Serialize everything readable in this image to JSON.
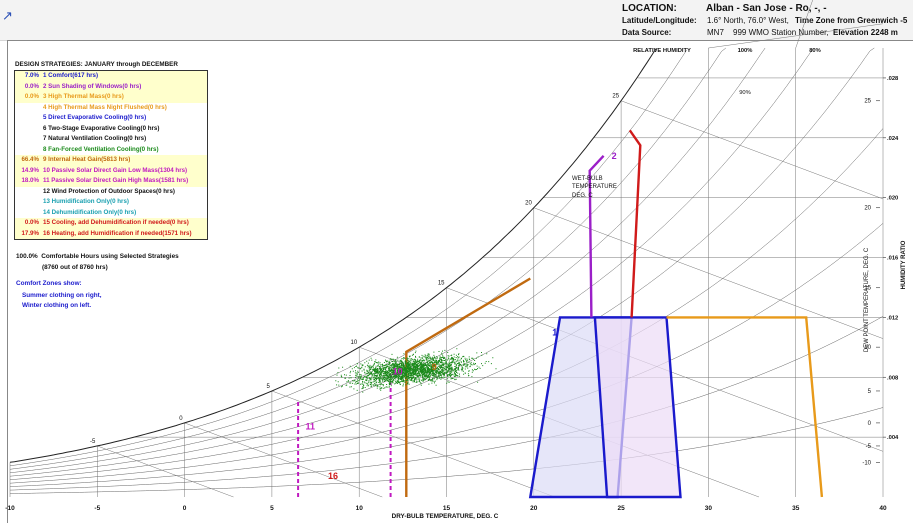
{
  "header": {
    "location_label": "LOCATION:",
    "location_value": "Alban - San Jose - Ro, -, -",
    "latlon_label": "Latitude/Longitude:",
    "latlon_value": "1.6° North, 76.0° West,",
    "timezone_label": "Time Zone from Greenwich -5",
    "source_label": "Data Source:",
    "source_code": "MN7",
    "source_value": "999 WMO Station Number,",
    "elevation_label": "Elevation 2248 m"
  },
  "design_title": "DESIGN STRATEGIES: JANUARY through DECEMBER",
  "strategies": [
    {
      "pct": "7.0%",
      "text": "1 Comfort(617 hrs)",
      "color": "#1a1acc",
      "bg": "#ffffcc"
    },
    {
      "pct": "0.0%",
      "text": "2 Sun Shading of Windows(0 hrs)",
      "color": "#9b1fc8",
      "bg": "#ffffcc"
    },
    {
      "pct": "0.0%",
      "text": "3 High Thermal Mass(0 hrs)",
      "color": "#e89a1a",
      "bg": "#ffffcc"
    },
    {
      "pct": "",
      "text": "4 High Thermal Mass Night Flushed(0 hrs)",
      "color": "#e89a1a",
      "bg": "#ffffff"
    },
    {
      "pct": "",
      "text": "5 Direct Evaporative Cooling(0 hrs)",
      "color": "#1a1acc",
      "bg": "#ffffff"
    },
    {
      "pct": "",
      "text": "6 Two-Stage Evaporative Cooling(0 hrs)",
      "color": "#111111",
      "bg": "#ffffff"
    },
    {
      "pct": "",
      "text": "7 Natural Ventilation Cooling(0 hrs)",
      "color": "#111111",
      "bg": "#ffffff"
    },
    {
      "pct": "",
      "text": "8 Fan-Forced Ventilation Cooling(0 hrs)",
      "color": "#1a8a1a",
      "bg": "#ffffff"
    },
    {
      "pct": "66.4%",
      "text": "9 Internal Heat Gain(5813 hrs)",
      "color": "#c06a10",
      "bg": "#ffffcc"
    },
    {
      "pct": "14.9%",
      "text": "10 Passive Solar Direct Gain Low Mass(1304 hrs)",
      "color": "#c01ac0",
      "bg": "#ffffcc"
    },
    {
      "pct": "18.0%",
      "text": "11 Passive Solar Direct Gain High Mass(1581 hrs)",
      "color": "#c01ac0",
      "bg": "#ffffcc"
    },
    {
      "pct": "",
      "text": "12 Wind Protection of Outdoor Spaces(0 hrs)",
      "color": "#111111",
      "bg": "#ffffff"
    },
    {
      "pct": "",
      "text": "13 Humidification Only(0 hrs)",
      "color": "#1aa0b0",
      "bg": "#ffffff"
    },
    {
      "pct": "",
      "text": "14 Dehumidification Only(0 hrs)",
      "color": "#1aa0b0",
      "bg": "#ffffff"
    },
    {
      "pct": "0.0%",
      "text": "15 Cooling, add Dehumidification if needed(0 hrs)",
      "color": "#d01a1a",
      "bg": "#ffffcc"
    },
    {
      "pct": "17.9%",
      "text": "16 Heating, add Humidification if needed(1571 hrs)",
      "color": "#d01a1a",
      "bg": "#ffffcc"
    }
  ],
  "summary": {
    "line1_pct": "100.0%",
    "line1": "Comfortable Hours using Selected Strategies",
    "line2": "(8760 out of 8760 hrs)"
  },
  "comfort_note": {
    "title": "Comfort Zones show:",
    "summer": "Summer clothing on right,",
    "winter": "Winter clothing on left."
  },
  "chart_data": {
    "type": "scatter",
    "xlabel": "DRY-BULB TEMPERATURE, DEG. C",
    "ylabel": "HUMIDITY RATIO",
    "dewpoint_label": "DEW POINT TEMPERATURE, DEG. C",
    "wetbulb_label": [
      "WET-BULB",
      "TEMPERATURE",
      "DEG. C"
    ],
    "rh_header": "RELATIVE HUMIDITY",
    "xlim": [
      -10,
      40
    ],
    "ylim": [
      0,
      0.03
    ],
    "x_ticks": [
      "-10",
      "-5",
      "0",
      "5",
      "10",
      "15",
      "20",
      "25",
      "30",
      "35",
      "40"
    ],
    "y_ticks": [
      0.004,
      0.008,
      0.012,
      0.016,
      0.02,
      0.024,
      0.028
    ],
    "y_tick_labels": [
      ".004",
      ".008",
      ".012",
      ".016",
      ".020",
      ".024",
      ".028"
    ],
    "dewpoint_ticks": [
      -10,
      -5,
      0,
      5,
      10,
      15,
      20,
      25,
      30
    ],
    "dewpoint_tick_labels": [
      "-10",
      "-5",
      "0",
      "5",
      "10",
      "15",
      "20",
      "25",
      "30"
    ],
    "rh_lines": [
      10,
      20,
      30,
      40,
      50,
      60,
      70,
      80,
      90,
      100
    ],
    "rh_labels": [
      {
        "rh": 100,
        "text": "100%"
      },
      {
        "rh": 90,
        "text": "90%"
      },
      {
        "rh": 80,
        "text": "80%"
      }
    ],
    "wetbulb_labels": [
      {
        "t": -5,
        "text": "-5"
      },
      {
        "t": 0,
        "text": "0"
      },
      {
        "t": 5,
        "text": "5"
      },
      {
        "t": 10,
        "text": "10"
      },
      {
        "t": 15,
        "text": "15"
      },
      {
        "t": 20,
        "text": "20"
      },
      {
        "t": 25,
        "text": "25"
      },
      {
        "t": 30,
        "text": "30"
      }
    ],
    "hourly_points": {
      "count": 8760,
      "color": "#1a8a1a",
      "db_range": [
        6,
        23
      ],
      "w_range": [
        0.004,
        0.012
      ],
      "center": {
        "db": 13,
        "w": 0.0085
      }
    },
    "zones": [
      {
        "id": "winter_comfort",
        "color": "#1a1acc",
        "fill": "#dcdcf6",
        "points": [
          [
            19.8,
            0
          ],
          [
            21.5,
            0.012
          ],
          [
            25.6,
            0.012
          ],
          [
            24.8,
            0
          ]
        ]
      },
      {
        "id": "summer_comfort",
        "color": "#1a1acc",
        "fill": "#ecdcf6",
        "points": [
          [
            24.2,
            0
          ],
          [
            23.5,
            0.012
          ],
          [
            27.6,
            0.012
          ],
          [
            28.4,
            0
          ]
        ]
      },
      {
        "id": "internal_heat_gain",
        "color": "#c06a10",
        "points": [
          [
            12.7,
            0
          ],
          [
            12.7,
            0.0097
          ],
          [
            19.8,
            0.0146
          ]
        ]
      },
      {
        "id": "high_thermal_mass",
        "color": "#e89a1a",
        "points": [
          [
            27.6,
            0.012
          ],
          [
            35.6,
            0.012
          ],
          [
            36.5,
            0
          ]
        ]
      },
      {
        "id": "sun_shading",
        "color": "#9b1fc8",
        "points": [
          [
            23.3,
            0.012
          ],
          [
            23.2,
            0.0218
          ],
          [
            24.0,
            0.0228
          ]
        ]
      },
      {
        "id": "cooling",
        "color": "#d01a1a",
        "points": [
          [
            25.6,
            0.012
          ],
          [
            26.1,
            0.0235
          ],
          [
            25.5,
            0.0245
          ]
        ]
      },
      {
        "id": "passive_solar_low_mass",
        "color": "#c01ac0",
        "dashed": true,
        "points": [
          [
            6.5,
            0
          ],
          [
            6.5,
            0.0065
          ]
        ]
      },
      {
        "id": "passive_solar_high_mass",
        "color": "#c01ac0",
        "dashed": true,
        "points": [
          [
            11.8,
            0
          ],
          [
            11.8,
            0.0083
          ]
        ]
      }
    ],
    "zone_labels": [
      {
        "text": "16",
        "color": "#d01a1a"
      },
      {
        "text": "11",
        "color": "#c01ac0"
      },
      {
        "text": "10",
        "color": "#c01ac0"
      },
      {
        "text": "9",
        "color": "#c06a10"
      },
      {
        "text": "2",
        "color": "#9b1fc8"
      },
      {
        "text": "1",
        "color": "#1a1acc"
      }
    ]
  }
}
